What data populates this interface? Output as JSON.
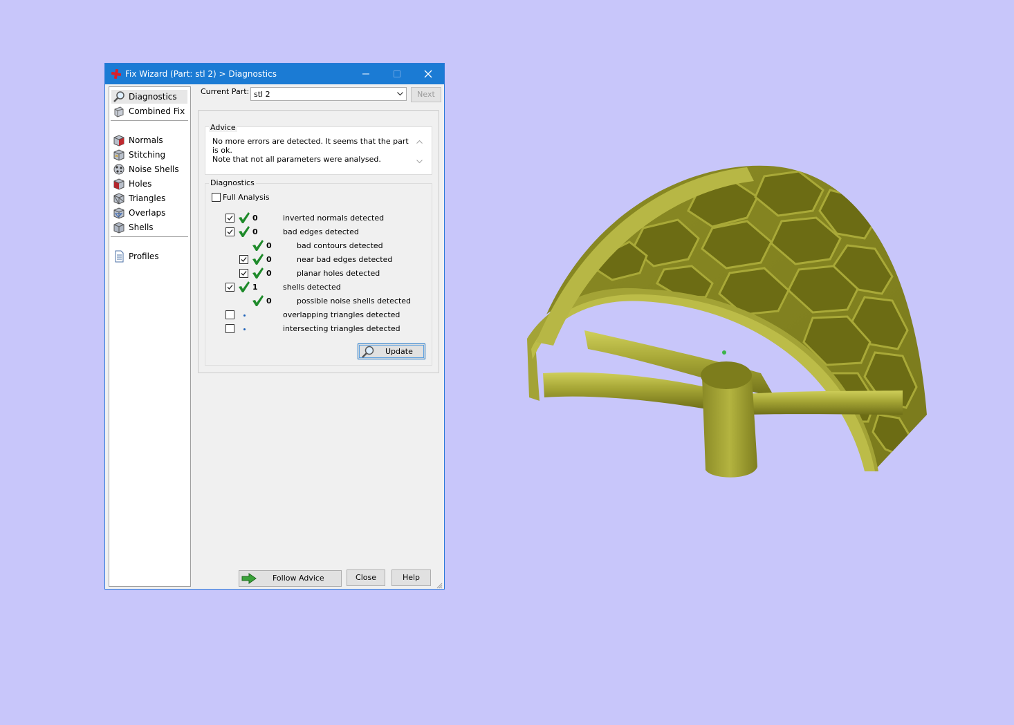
{
  "window": {
    "title": "Fix Wizard (Part: stl 2) > Diagnostics",
    "controls": [
      "minimize",
      "maximize",
      "close"
    ]
  },
  "sidebar": {
    "items": [
      {
        "label": "Diagnostics",
        "icon": "magnifier-icon",
        "selected": true
      },
      {
        "label": "Combined Fix",
        "icon": "combined-fix-icon"
      },
      {
        "label": "Normals",
        "icon": "normals-cube-icon"
      },
      {
        "label": "Stitching",
        "icon": "stitching-cube-icon"
      },
      {
        "label": "Noise Shells",
        "icon": "noise-shells-icon"
      },
      {
        "label": "Holes",
        "icon": "holes-cube-icon"
      },
      {
        "label": "Triangles",
        "icon": "triangles-cube-icon"
      },
      {
        "label": "Overlaps",
        "icon": "overlaps-cube-icon"
      },
      {
        "label": "Shells",
        "icon": "shells-cube-icon"
      },
      {
        "label": "Profiles",
        "icon": "profiles-document-icon"
      }
    ]
  },
  "toolbar": {
    "current_part_label": "Current Part:",
    "current_part_value": "stl 2",
    "next_label": "Next"
  },
  "advice": {
    "title": "Advice",
    "line1": "No more errors are detected. It seems that the part is ok.",
    "line2": "Note that not all parameters were analysed."
  },
  "diagnostics": {
    "title": "Diagnostics",
    "full_analysis_label": "Full Analysis",
    "full_analysis_checked": false,
    "rows": [
      {
        "checked": true,
        "status": "ok",
        "count": "0",
        "label": "inverted normals detected"
      },
      {
        "checked": true,
        "status": "ok",
        "count": "0",
        "label": "bad edges detected"
      },
      {
        "checkbox": false,
        "status": "ok",
        "count": "0",
        "label": "bad contours detected"
      },
      {
        "checked": true,
        "status": "ok",
        "count": "0",
        "label": "near bad edges detected"
      },
      {
        "checked": true,
        "status": "ok",
        "count": "0",
        "label": "planar holes detected"
      },
      {
        "checked": true,
        "status": "ok",
        "count": "1",
        "label": "shells detected"
      },
      {
        "checkbox": false,
        "status": "ok",
        "count": "0",
        "label": "possible noise shells detected"
      },
      {
        "checked": false,
        "status": "not-analysed",
        "label": "overlapping triangles detected"
      },
      {
        "checked": false,
        "status": "not-analysed",
        "label": "intersecting triangles detected"
      }
    ],
    "update_label": "Update"
  },
  "footer": {
    "follow_advice_label": "Follow Advice",
    "close_label": "Close",
    "help_label": "Help"
  },
  "colors": {
    "background": "#c8c6fa",
    "title_bar": "#1b7bd4",
    "model": "#9a9a2e",
    "check_green": "#1e8a2a"
  }
}
